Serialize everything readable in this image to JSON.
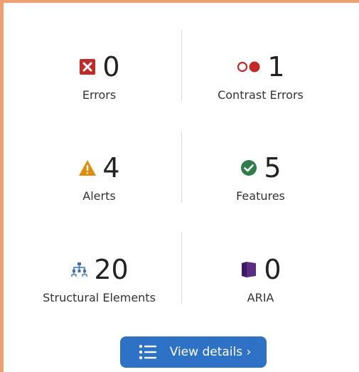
{
  "stats": {
    "errors": {
      "icon": "error-x-icon",
      "count": "0",
      "label": "Errors",
      "color": "#c62828"
    },
    "contrast_errors": {
      "icon": "contrast-icon",
      "count": "1",
      "label": "Contrast Errors",
      "color": "#c62828"
    },
    "alerts": {
      "icon": "alert-triangle-icon",
      "count": "4",
      "label": "Alerts",
      "color": "#e38b06"
    },
    "features": {
      "icon": "check-circle-icon",
      "count": "5",
      "label": "Features",
      "color": "#2e7d4b"
    },
    "structural": {
      "icon": "structure-tree-icon",
      "count": "20",
      "label": "Structural Elements",
      "color": "#3a6fc4"
    },
    "aria": {
      "icon": "aria-shield-icon",
      "count": "0",
      "label": "ARIA",
      "color": "#5a2d82"
    }
  },
  "button": {
    "label": "View details ›",
    "icon": "list-icon",
    "color": "#2d72c6"
  },
  "frame": {
    "accent": "#f0a070"
  }
}
